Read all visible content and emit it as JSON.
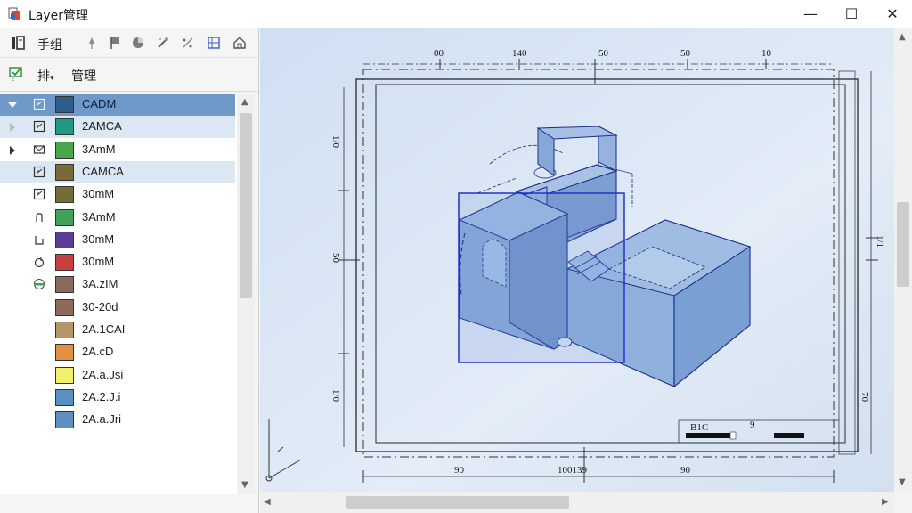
{
  "window": {
    "title": "Layer管理",
    "minimize_glyph": "—",
    "maximize_glyph": "☐",
    "close_glyph": "✕"
  },
  "toolbar": {
    "row1_label": "手组",
    "row2_label_a": "排",
    "row2_label_b": "管理"
  },
  "layers": [
    {
      "name": "CADM",
      "color": "#2f5f88",
      "expander": "down",
      "selected": true
    },
    {
      "name": "2AMCA",
      "color": "#1f9a83",
      "expander": "right",
      "highlighted": true
    },
    {
      "name": "3AmM",
      "color": "#4aa64b",
      "expander": "right-dark"
    },
    {
      "name": "CAMCA",
      "color": "#7a6a3a",
      "highlighted": true
    },
    {
      "name": "30mM",
      "color": "#736b38"
    },
    {
      "name": "3AmM",
      "color": "#3fa35a"
    },
    {
      "name": "30mM",
      "color": "#5b3c97"
    },
    {
      "name": "30mM",
      "color": "#c8403d"
    },
    {
      "name": "3A.zIM",
      "color": "#8b6a5c"
    },
    {
      "name": "30-20d",
      "color": "#8e6a5a"
    },
    {
      "name": "2A.1CAI",
      "color": "#b49767"
    },
    {
      "name": "2A.cD",
      "color": "#e38f44"
    },
    {
      "name": "2A.a.Jsi",
      "color": "#f2ef6c"
    },
    {
      "name": "2A.2.J.i",
      "color": "#5a8fc4"
    },
    {
      "name": "2A.a.Jri",
      "color": "#5d8fc0"
    }
  ],
  "drawing": {
    "top_dims": [
      "00",
      "140",
      "50",
      "50",
      "10"
    ],
    "left_dims": [
      "1/0",
      "50",
      "1/0"
    ],
    "right_dims": [
      "1/1",
      "70"
    ],
    "bottom_dims": [
      "90",
      "100139",
      "90"
    ],
    "title_block_a": "B1C",
    "title_block_b": "9"
  }
}
